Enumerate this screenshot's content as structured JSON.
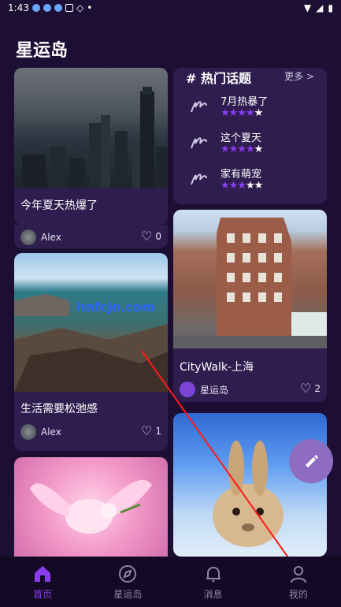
{
  "status_bar": {
    "time": "1:43"
  },
  "app": {
    "title": "星运岛"
  },
  "feed": {
    "left": [
      {
        "title": "今年夏天热爆了",
        "author": "Alex",
        "likes": "0"
      },
      {
        "title": "生活需要松弛感",
        "author": "Alex",
        "likes": "1"
      }
    ],
    "right": [
      {
        "title": "CityWalk-上海",
        "author": "星运岛",
        "likes": "2"
      }
    ]
  },
  "topics": {
    "header": "# 热门话题",
    "more": "更多 >",
    "items": [
      {
        "name": "7月热暴了",
        "rating": 4,
        "max": 5
      },
      {
        "name": "这个夏天",
        "rating": 4,
        "max": 5
      },
      {
        "name": "家有萌宠",
        "rating": 3,
        "max": 5
      }
    ]
  },
  "watermark": "hnfcjn.com",
  "nav": {
    "items": [
      {
        "label": "首页"
      },
      {
        "label": "星运岛"
      },
      {
        "label": "消息"
      },
      {
        "label": "我的"
      }
    ]
  },
  "colors": {
    "background": "#1d0f33",
    "card": "#2e1d4e",
    "accent": "#8a3df0",
    "fab": "#8d6cc1",
    "nav_bg": "#150a25"
  }
}
